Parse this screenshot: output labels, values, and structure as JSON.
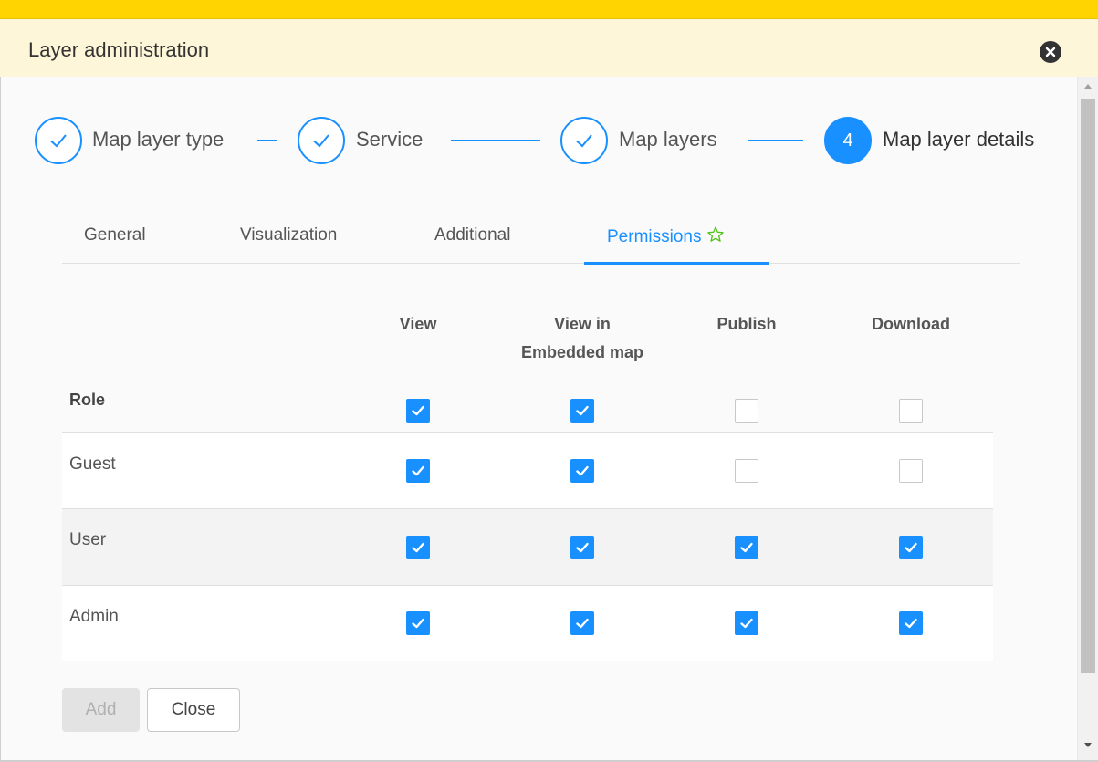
{
  "dialog": {
    "title": "Layer administration",
    "close_icon": "close-icon"
  },
  "steps": [
    {
      "label": "Map layer type",
      "state": "done",
      "icon": "check-icon"
    },
    {
      "label": "Service",
      "state": "done",
      "icon": "check-icon"
    },
    {
      "label": "Map layers",
      "state": "done",
      "icon": "check-icon"
    },
    {
      "label": "Map layer details",
      "state": "active",
      "number": "4"
    }
  ],
  "tabs": [
    {
      "label": "General",
      "active": false
    },
    {
      "label": "Visualization",
      "active": false
    },
    {
      "label": "Additional",
      "active": false
    },
    {
      "label": "Permissions",
      "active": true,
      "icon": "star-icon"
    }
  ],
  "permissions": {
    "columns": [
      {
        "line1": "View",
        "line2": ""
      },
      {
        "line1": "View in",
        "line2": "Embedded map"
      },
      {
        "line1": "Publish",
        "line2": ""
      },
      {
        "line1": "Download",
        "line2": ""
      }
    ],
    "header_row": {
      "label": "Role",
      "values": [
        true,
        true,
        false,
        false
      ]
    },
    "rows": [
      {
        "role": "Guest",
        "values": [
          true,
          true,
          false,
          false
        ]
      },
      {
        "role": "User",
        "values": [
          true,
          true,
          true,
          true
        ]
      },
      {
        "role": "Admin",
        "values": [
          true,
          true,
          true,
          true
        ]
      }
    ]
  },
  "buttons": {
    "add_label": "Add",
    "add_disabled": true,
    "close_label": "Close"
  },
  "colors": {
    "accent": "#1890ff",
    "topbar": "#ffd400",
    "header_bg": "#fdf6d8",
    "star": "#52c41a"
  }
}
